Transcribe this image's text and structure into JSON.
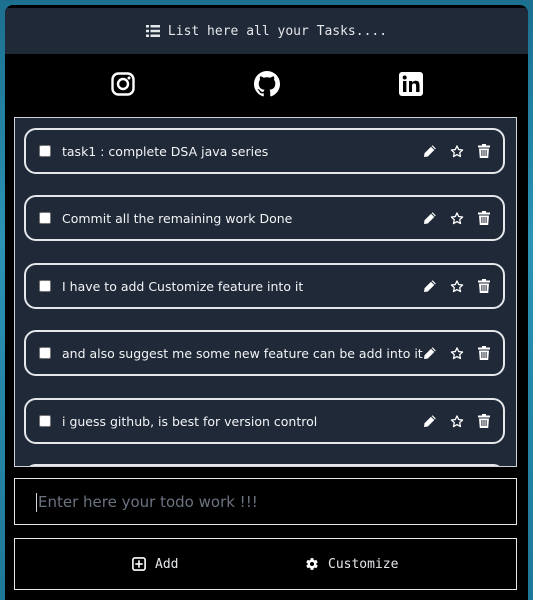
{
  "header": {
    "title": "List here all your Tasks....",
    "icon": "list-icon"
  },
  "social": [
    {
      "name": "instagram",
      "icon": "instagram-icon"
    },
    {
      "name": "github",
      "icon": "github-icon"
    },
    {
      "name": "linkedin",
      "icon": "linkedin-icon"
    }
  ],
  "tasks": [
    {
      "text": "task1 : complete DSA java series"
    },
    {
      "text": "Commit all the remaining work Done"
    },
    {
      "text": "I have to add Customize feature into it"
    },
    {
      "text": "and also suggest me some new feature can be add into it"
    },
    {
      "text": "i guess github, is best for version control"
    }
  ],
  "input": {
    "placeholder": "Enter here your todo work !!!",
    "value": ""
  },
  "buttons": {
    "add_label": "Add",
    "customize_label": "Customize"
  },
  "colors": {
    "header_bg": "#1f2937",
    "panel_bg": "#1f2937",
    "popup_bg": "#000000",
    "text": "#e5e7eb"
  }
}
